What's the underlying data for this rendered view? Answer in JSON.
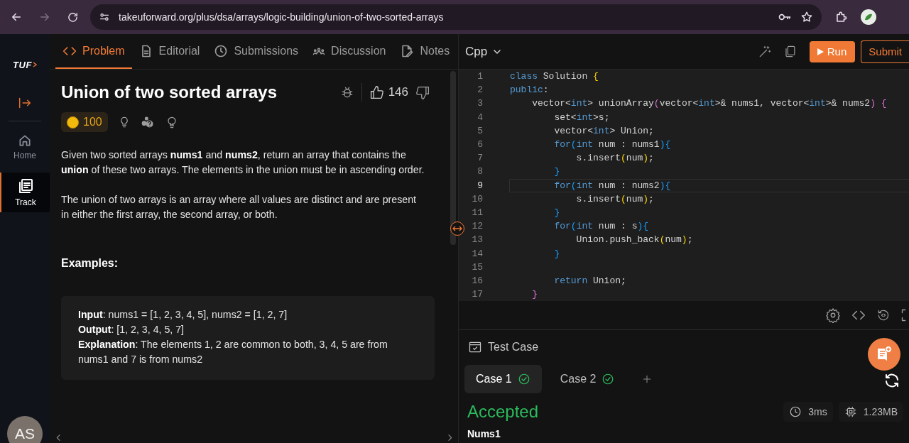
{
  "browser": {
    "url": "takeuforward.org/plus/dsa/arrays/logic-building/union-of-two-sorted-arrays"
  },
  "sidebar": {
    "logo": "TUF",
    "items": [
      {
        "label": "Home",
        "selected": false
      },
      {
        "label": "Track",
        "selected": true
      }
    ],
    "avatar": "AS"
  },
  "problem_tabs": [
    {
      "label": "Problem",
      "selected": true
    },
    {
      "label": "Editorial",
      "selected": false
    },
    {
      "label": "Submissions",
      "selected": false
    },
    {
      "label": "Discussion",
      "selected": false
    },
    {
      "label": "Notes",
      "selected": false
    }
  ],
  "problem": {
    "title": "Union of two sorted arrays",
    "likes": "146",
    "coins": "100",
    "description": [
      "Given two sorted arrays **nums1** and **nums2**, return an array that contains the **union** of these two arrays. The elements in the union must be in ascending order.",
      "The union of two arrays is an array where all values are distinct and are present in either the first array, the second array, or both."
    ],
    "examples_heading": "Examples:",
    "example": [
      "**Input**: nums1 = [1, 2, 3, 4, 5], nums2 = [1, 2, 7]",
      "**Output**: [1, 2, 3, 4, 5, 7]",
      "**Explanation**: The elements 1, 2 are common to both, 3, 4, 5 are from nums1 and 7 is from nums2"
    ]
  },
  "editor": {
    "language": "Cpp",
    "run": "Run",
    "submit": "Submit",
    "lines": [
      {
        "number": "1",
        "current": false,
        "tokens": [
          {
            "text": "class",
            "kind": "kw"
          },
          {
            "text": " Solution ",
            "kind": "plain"
          },
          {
            "text": "{",
            "kind": "br1"
          }
        ]
      },
      {
        "number": "2",
        "current": false,
        "tokens": [
          {
            "text": "public",
            "kind": "kw"
          },
          {
            "text": ":",
            "kind": "plain"
          }
        ]
      },
      {
        "number": "3",
        "current": false,
        "tokens": [
          {
            "text": "    vector<",
            "kind": "plain"
          },
          {
            "text": "int",
            "kind": "kw"
          },
          {
            "text": "> unionArray",
            "kind": "plain"
          },
          {
            "text": "(",
            "kind": "br2"
          },
          {
            "text": "vector<",
            "kind": "plain"
          },
          {
            "text": "int",
            "kind": "kw"
          },
          {
            "text": ">& nums1, vector<",
            "kind": "plain"
          },
          {
            "text": "int",
            "kind": "kw"
          },
          {
            "text": ">& nums2",
            "kind": "plain"
          },
          {
            "text": ")",
            "kind": "br2"
          },
          {
            "text": " {",
            "kind": "br2"
          }
        ]
      },
      {
        "number": "4",
        "current": false,
        "tokens": [
          {
            "text": "        set<",
            "kind": "plain"
          },
          {
            "text": "int",
            "kind": "kw"
          },
          {
            "text": ">s;",
            "kind": "plain"
          }
        ]
      },
      {
        "number": "5",
        "current": false,
        "tokens": [
          {
            "text": "        vector<",
            "kind": "plain"
          },
          {
            "text": "int",
            "kind": "kw"
          },
          {
            "text": "> Union;",
            "kind": "plain"
          }
        ]
      },
      {
        "number": "6",
        "current": false,
        "tokens": [
          {
            "text": "        for",
            "kind": "kw"
          },
          {
            "text": "(",
            "kind": "br3"
          },
          {
            "text": "int",
            "kind": "kw"
          },
          {
            "text": " num : nums1",
            "kind": "plain"
          },
          {
            "text": "){",
            "kind": "br3"
          }
        ]
      },
      {
        "number": "7",
        "current": false,
        "tokens": [
          {
            "text": "            s.insert",
            "kind": "plain"
          },
          {
            "text": "(",
            "kind": "br1"
          },
          {
            "text": "num",
            "kind": "plain"
          },
          {
            "text": ")",
            "kind": "br1"
          },
          {
            "text": ";",
            "kind": "plain"
          }
        ]
      },
      {
        "number": "8",
        "current": false,
        "tokens": [
          {
            "text": "        }",
            "kind": "br3"
          }
        ]
      },
      {
        "number": "9",
        "current": true,
        "tokens": [
          {
            "text": "        for",
            "kind": "kw"
          },
          {
            "text": "(",
            "kind": "br3"
          },
          {
            "text": "int",
            "kind": "kw"
          },
          {
            "text": " num : nums2",
            "kind": "plain"
          },
          {
            "text": "){",
            "kind": "br3"
          }
        ]
      },
      {
        "number": "10",
        "current": false,
        "tokens": [
          {
            "text": "            s.insert",
            "kind": "plain"
          },
          {
            "text": "(",
            "kind": "br1"
          },
          {
            "text": "num",
            "kind": "plain"
          },
          {
            "text": ")",
            "kind": "br1"
          },
          {
            "text": ";",
            "kind": "plain"
          }
        ]
      },
      {
        "number": "11",
        "current": false,
        "tokens": [
          {
            "text": "        }",
            "kind": "br3"
          }
        ]
      },
      {
        "number": "12",
        "current": false,
        "tokens": [
          {
            "text": "        for",
            "kind": "kw"
          },
          {
            "text": "(",
            "kind": "br3"
          },
          {
            "text": "int",
            "kind": "kw"
          },
          {
            "text": " num : s",
            "kind": "plain"
          },
          {
            "text": "){",
            "kind": "br3"
          }
        ]
      },
      {
        "number": "13",
        "current": false,
        "tokens": [
          {
            "text": "            Union.push_back",
            "kind": "plain"
          },
          {
            "text": "(",
            "kind": "br1"
          },
          {
            "text": "num",
            "kind": "plain"
          },
          {
            "text": ")",
            "kind": "br1"
          },
          {
            "text": ";",
            "kind": "plain"
          }
        ]
      },
      {
        "number": "14",
        "current": false,
        "tokens": [
          {
            "text": "        }",
            "kind": "br3"
          }
        ]
      },
      {
        "number": "15",
        "current": false
      },
      {
        "number": "16",
        "current": false,
        "tokens": [
          {
            "text": "        return",
            "kind": "kw"
          },
          {
            "text": " Union;",
            "kind": "plain"
          }
        ]
      },
      {
        "number": "17",
        "current": false,
        "tokens": [
          {
            "text": "    }",
            "kind": "br2"
          }
        ]
      }
    ]
  },
  "test_panel": {
    "title": "Test Case",
    "cases": [
      {
        "label": "Case 1",
        "selected": true,
        "passed": true
      },
      {
        "label": "Case 2",
        "selected": false,
        "passed": true
      }
    ],
    "status": "Accepted",
    "runtime": "3ms",
    "memory": "1.23MB",
    "field_label": "Nums1"
  }
}
